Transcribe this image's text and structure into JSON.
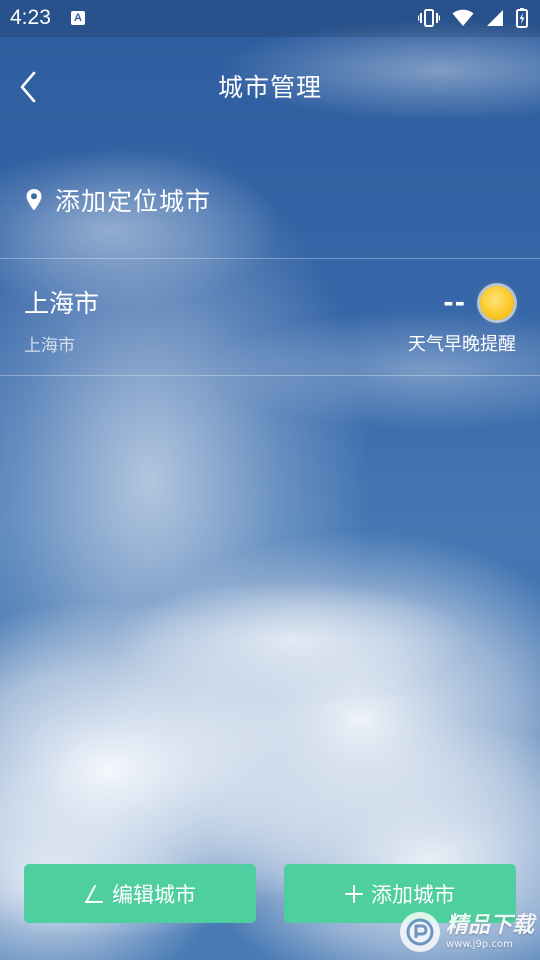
{
  "status_bar": {
    "time": "4:23",
    "notification_letter": "A",
    "icons": [
      "vibrate-icon",
      "wifi-icon",
      "signal-icon",
      "battery-icon"
    ]
  },
  "header": {
    "title": "城市管理",
    "back_icon": "chevron-left-icon"
  },
  "add_location": {
    "label": "添加定位城市",
    "icon": "location-pin-icon"
  },
  "cities": [
    {
      "name": "上海市",
      "subtitle": "上海市",
      "temperature": "--",
      "weather_icon": "sun-icon",
      "reminder_label": "天气早晚提醒"
    }
  ],
  "buttons": {
    "edit_label": "编辑城市",
    "edit_icon": "pencil-icon",
    "add_label": "添加城市",
    "add_icon": "plus-icon"
  },
  "watermark": {
    "title": "精品下载",
    "url": "www.j9p.com"
  },
  "colors": {
    "button_green": "#4fcf9f",
    "sky_blue": "#3868a9",
    "sun_yellow": "#fcc928"
  }
}
